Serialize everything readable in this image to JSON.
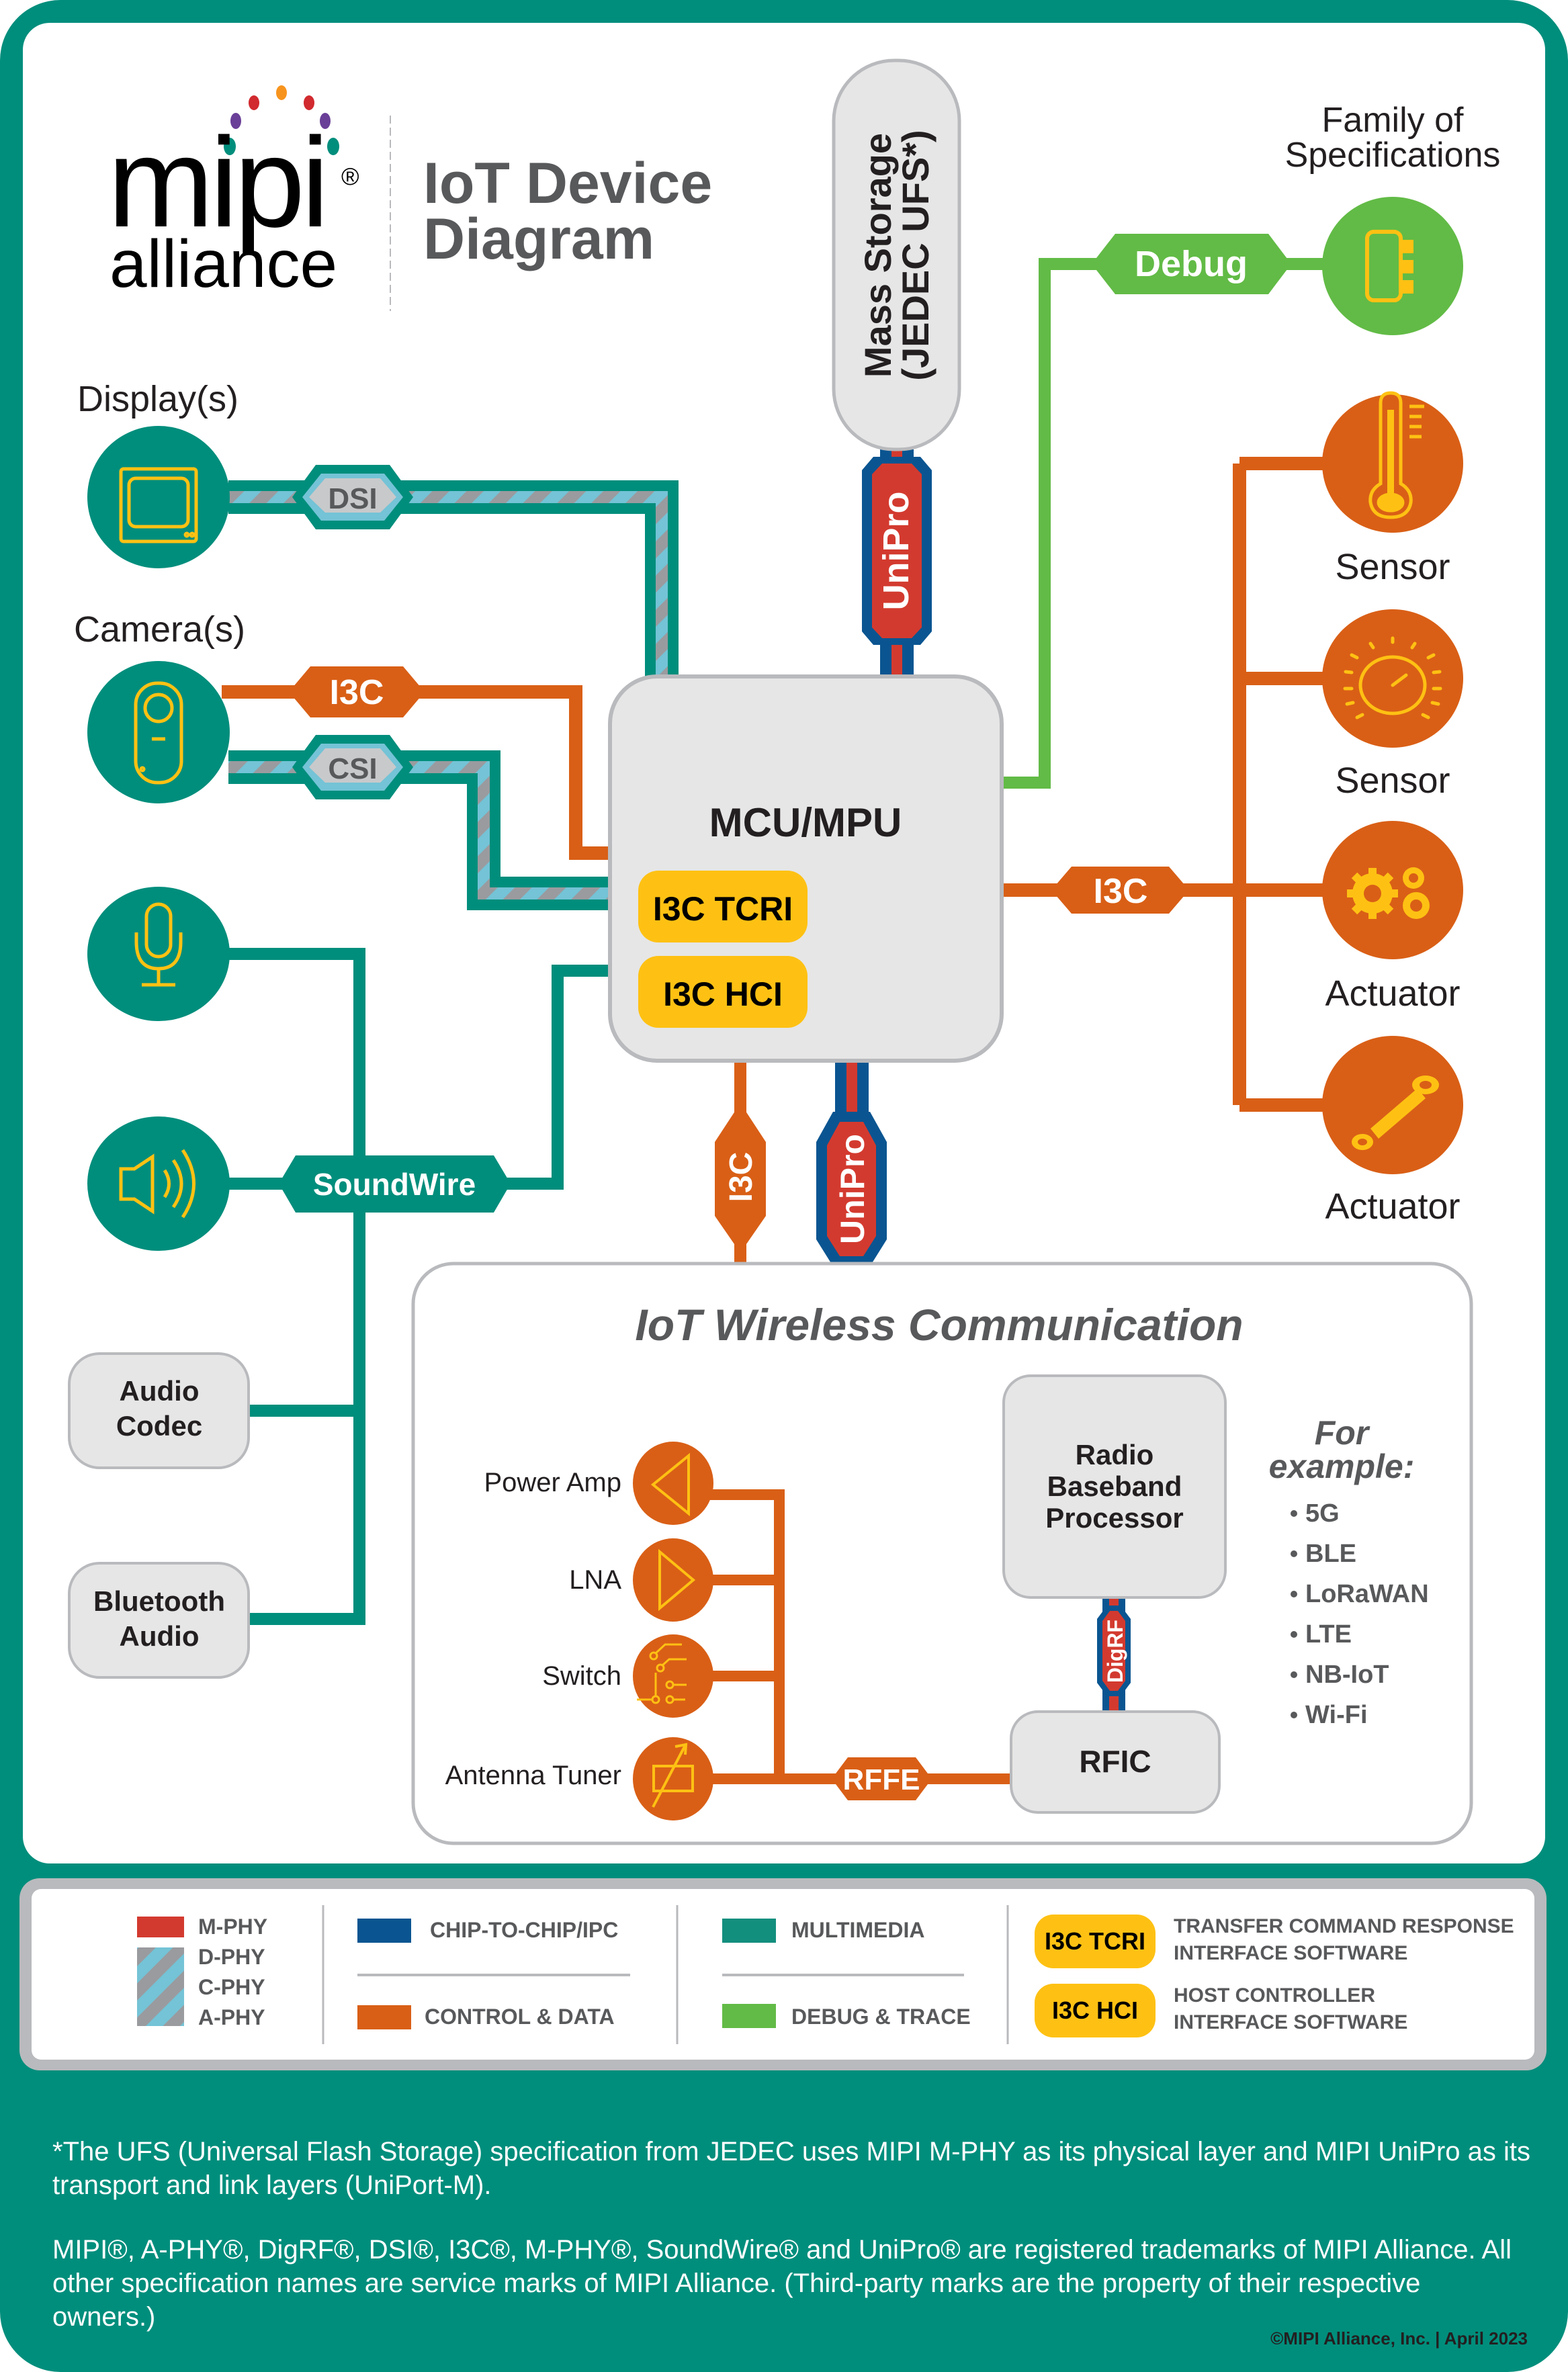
{
  "header": {
    "logo_word": "mipi",
    "logo_sub": "alliance",
    "logo_reg": "®",
    "title_line1": "IoT Device",
    "title_line2": "Diagram"
  },
  "colors": {
    "frame_teal": "#008e7c",
    "multimedia_teal": "#008e7c",
    "control_orange": "#d95f16",
    "debug_green": "#62bb46",
    "chip_blue": "#0a5591",
    "mphy_red": "#d33a2f",
    "dphy_light_blue": "#74c3d6",
    "dphy_gray": "#9a9b9f",
    "icon_yellow": "#fec113",
    "box_gray": "#e6e6e6",
    "box_border": "#b9babd",
    "text_dark": "#231f20",
    "text_gray": "#58595b"
  },
  "family_label": [
    "Family of",
    "Specifications"
  ],
  "mass_storage": {
    "line1": "Mass Storage",
    "line2": "(JEDEC UFS*)"
  },
  "mcu": {
    "title": "MCU/MPU",
    "badges": [
      "I3C TCRI",
      "I3C HCI"
    ]
  },
  "left_devices": [
    {
      "label": "Display(s)",
      "icon": "display-icon",
      "bus": "DSI"
    },
    {
      "label": "Camera(s)",
      "icon": "camera-icon",
      "bus": "CSI",
      "control_bus": "I3C"
    },
    {
      "label": "",
      "icon": "microphone-icon"
    },
    {
      "label": "",
      "icon": "speaker-icon"
    }
  ],
  "soundwire_label": "SoundWire",
  "audio_boxes": [
    {
      "line1": "Audio",
      "line2": "Codec"
    },
    {
      "line1": "Bluetooth",
      "line2": "Audio"
    }
  ],
  "buses": {
    "debug": "Debug",
    "unipro_top": "UniPro",
    "unipro_bottom": "UniPro",
    "i3c_right": "I3C",
    "i3c_bottom": "I3C",
    "rffe": "RFFE",
    "digrf": "DigRF"
  },
  "right_devices": [
    {
      "label": "Sensor",
      "icon": "thermometer-icon"
    },
    {
      "label": "Sensor",
      "icon": "gauge-icon"
    },
    {
      "label": "Actuator",
      "icon": "gears-icon"
    },
    {
      "label": "Actuator",
      "icon": "piston-icon"
    }
  ],
  "wireless": {
    "title": "IoT Wireless Communication",
    "rf_components": [
      {
        "label": "Power Amp",
        "icon": "power-amp-icon"
      },
      {
        "label": "LNA",
        "icon": "lna-icon"
      },
      {
        "label": "Switch",
        "icon": "switch-icon"
      },
      {
        "label": "Antenna Tuner",
        "icon": "antenna-tuner-icon"
      }
    ],
    "baseband": [
      "Radio",
      "Baseband",
      "Processor"
    ],
    "rfic": "RFIC",
    "examples_title": [
      "For",
      "example:"
    ],
    "examples": [
      "5G",
      "BLE",
      "LoRaWAN",
      "LTE",
      "NB-IoT",
      "Wi-Fi"
    ]
  },
  "legend": {
    "phy": [
      "M-PHY",
      "D-PHY",
      "C-PHY",
      "A-PHY"
    ],
    "chip_to_chip": "CHIP-TO-CHIP/IPC",
    "control_data": "CONTROL & DATA",
    "multimedia": "MULTIMEDIA",
    "debug_trace": "DEBUG & TRACE",
    "tcri_badge": "I3C TCRI",
    "tcri_desc": [
      "TRANSFER COMMAND RESPONSE",
      "INTERFACE SOFTWARE"
    ],
    "hci_badge": "I3C HCI",
    "hci_desc": [
      "HOST CONTROLLER",
      "INTERFACE SOFTWARE"
    ]
  },
  "footer": {
    "note": "*The UFS (Universal Flash Storage) specification from JEDEC uses MIPI M-PHY as its physical layer and MIPI UniPro as its transport and link layers (UniPort-M).",
    "trademarks": "MIPI®, A-PHY®, DigRF®, DSI®, I3C®, M-PHY®, SoundWire® and UniPro® are registered trademarks of MIPI Alliance. All other specification names are service marks of MIPI Alliance. (Third-party marks are the property of their respective owners.)",
    "copyright": "©MIPI Alliance, Inc. | April 2023"
  }
}
